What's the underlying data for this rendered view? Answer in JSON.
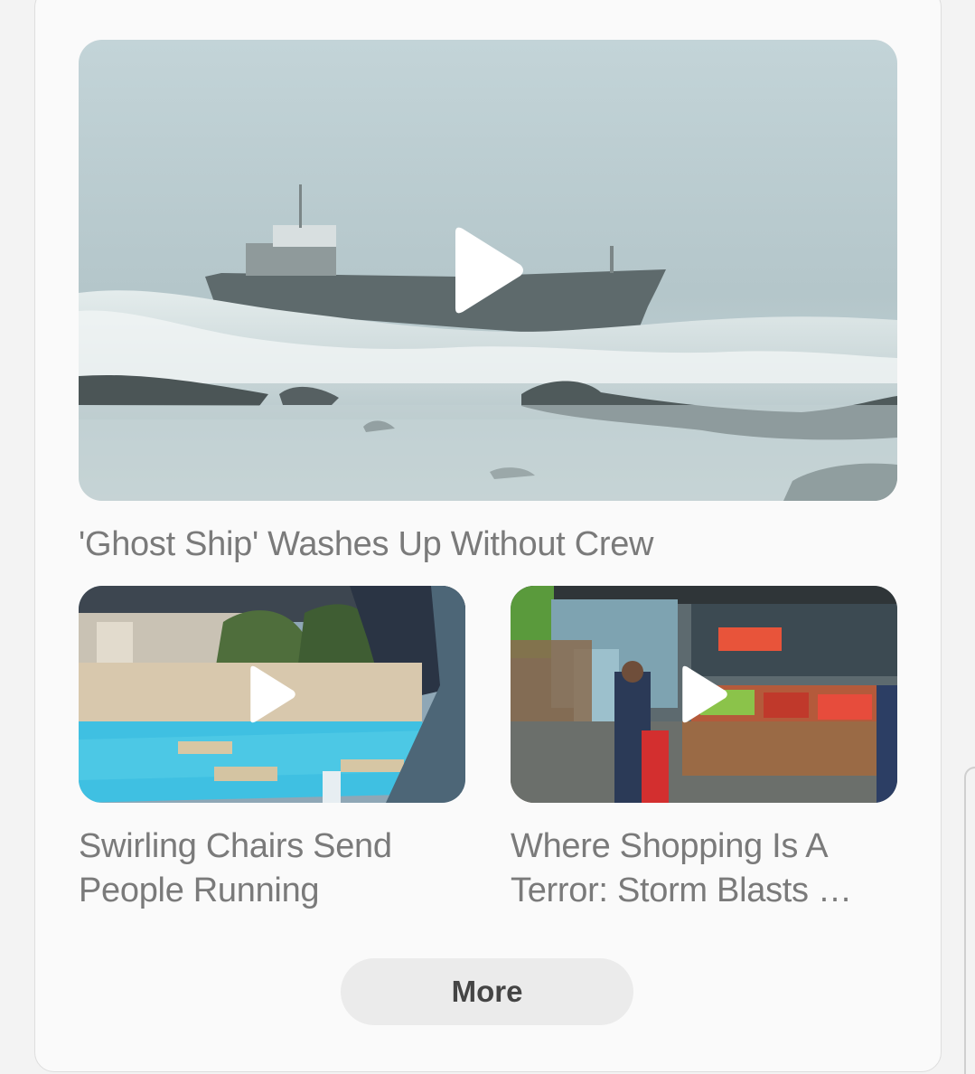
{
  "feed": {
    "featured": {
      "headline": "'Ghost Ship' Washes Up Without Crew",
      "thumbnail_icon": "play-icon"
    },
    "items": [
      {
        "headline_line1": "Swirling Chairs Send",
        "headline_line2": "People Running",
        "thumbnail_icon": "play-icon"
      },
      {
        "headline_line1": "Where Shopping Is A",
        "headline_line2": "Terror: Storm Blasts …",
        "thumbnail_icon": "play-icon"
      }
    ],
    "more_label": "More"
  },
  "colors": {
    "headline_text": "#7a7a7a",
    "button_bg": "#ebebeb",
    "card_bg": "#fafafa"
  }
}
